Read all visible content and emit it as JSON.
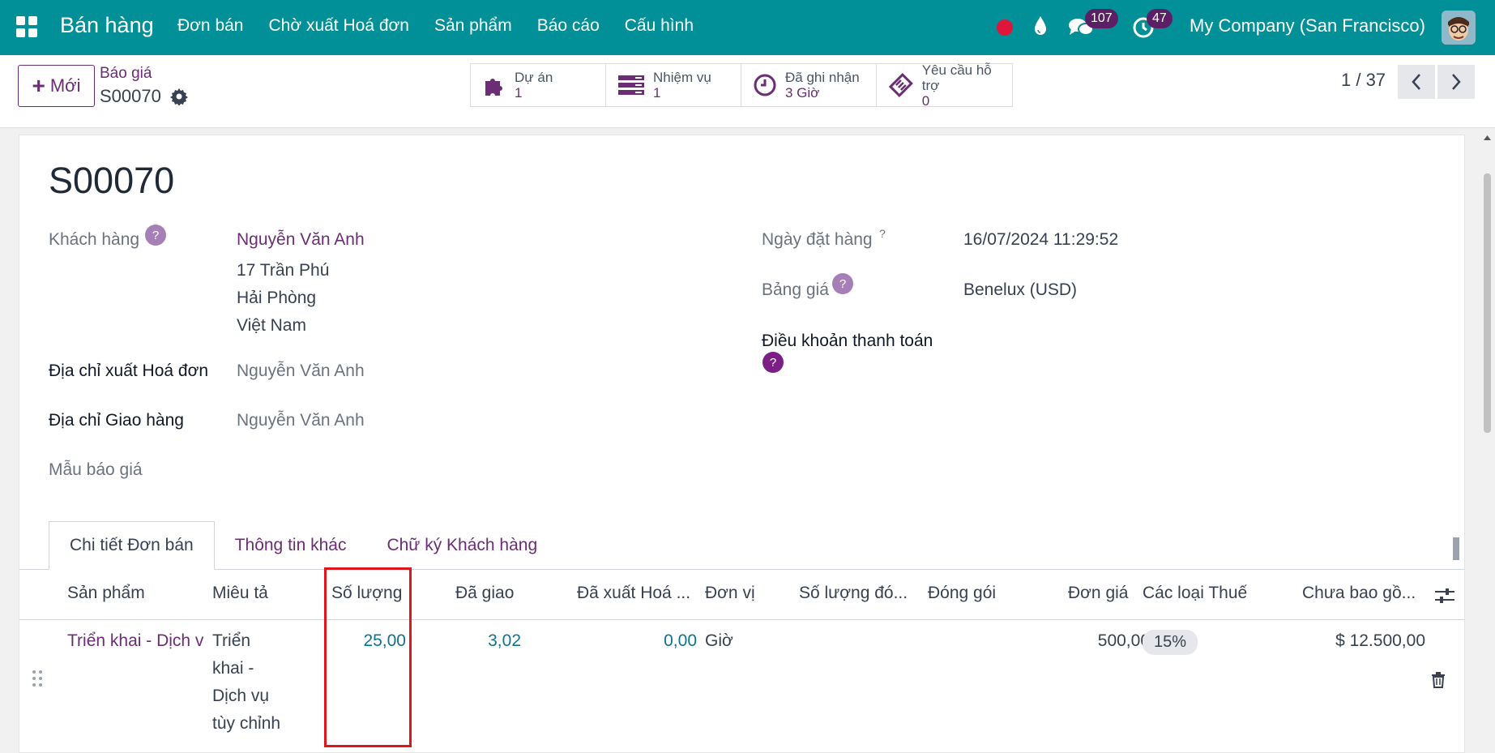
{
  "topnav": {
    "brand": "Bán hàng",
    "menu": [
      "Đơn bán",
      "Chờ xuất Hoá đơn",
      "Sản phẩm",
      "Báo cáo",
      "Cấu hình"
    ],
    "chat_count": "107",
    "activity_count": "47",
    "company": "My Company (San Francisco)"
  },
  "control": {
    "new_label": "Mới",
    "breadcrumb_parent": "Báo giá",
    "breadcrumb_current": "S00070",
    "smart_buttons": [
      {
        "label": "Dự án",
        "value": "1",
        "icon": "puzzle-icon"
      },
      {
        "label": "Nhiệm vụ",
        "value": "1",
        "icon": "tasks-icon"
      },
      {
        "label": "Đã ghi nhận",
        "value": "3 Giờ",
        "icon": "clock-icon"
      },
      {
        "label": "Yêu cầu hỗ trợ",
        "value": "0",
        "icon": "ticket-icon"
      }
    ],
    "pager": "1 / 37"
  },
  "form": {
    "title": "S00070",
    "customer_label": "Khách hàng",
    "customer_name": "Nguyễn Văn Anh",
    "address_lines": [
      "17 Trần Phú",
      "Hải Phòng",
      "Việt Nam"
    ],
    "invoice_address_label": "Địa chỉ xuất Hoá đơn",
    "invoice_address": "Nguyễn Văn Anh",
    "delivery_address_label": "Địa chỉ Giao hàng",
    "delivery_address": "Nguyễn Văn Anh",
    "quote_template_label": "Mẫu báo giá",
    "order_date_label": "Ngày đặt hàng",
    "order_date": "16/07/2024 11:29:52",
    "pricelist_label": "Bảng giá",
    "pricelist": "Benelux (USD)",
    "payment_terms_label": "Điều khoản thanh toán",
    "help_mark": "?"
  },
  "tabs": [
    "Chi tiết Đơn bán",
    "Thông tin khác",
    "Chữ ký Khách hàng"
  ],
  "table": {
    "headers": [
      "Sản phẩm",
      "Miêu tả",
      "Số lượng",
      "Đã giao",
      "Đã xuất Hoá ...",
      "Đơn vị",
      "Số lượng đó...",
      "Đóng gói",
      "Đơn giá",
      "Các loại Thuế",
      "Chưa bao gồ..."
    ],
    "row": {
      "product": "Triển khai - Dịch v",
      "description_lines": [
        "Triển",
        "khai -",
        "Dịch vụ",
        "tùy chỉnh"
      ],
      "quantity": "25,00",
      "delivered": "3,02",
      "invoiced": "0,00",
      "uom": "Giờ",
      "unit_price": "500,00",
      "tax": "15%",
      "subtotal": "$ 12.500,00"
    }
  },
  "colors": {
    "nav_bg": "#018f98",
    "brand_purple": "#6b2d73",
    "highlight_box": "#e0161c"
  }
}
